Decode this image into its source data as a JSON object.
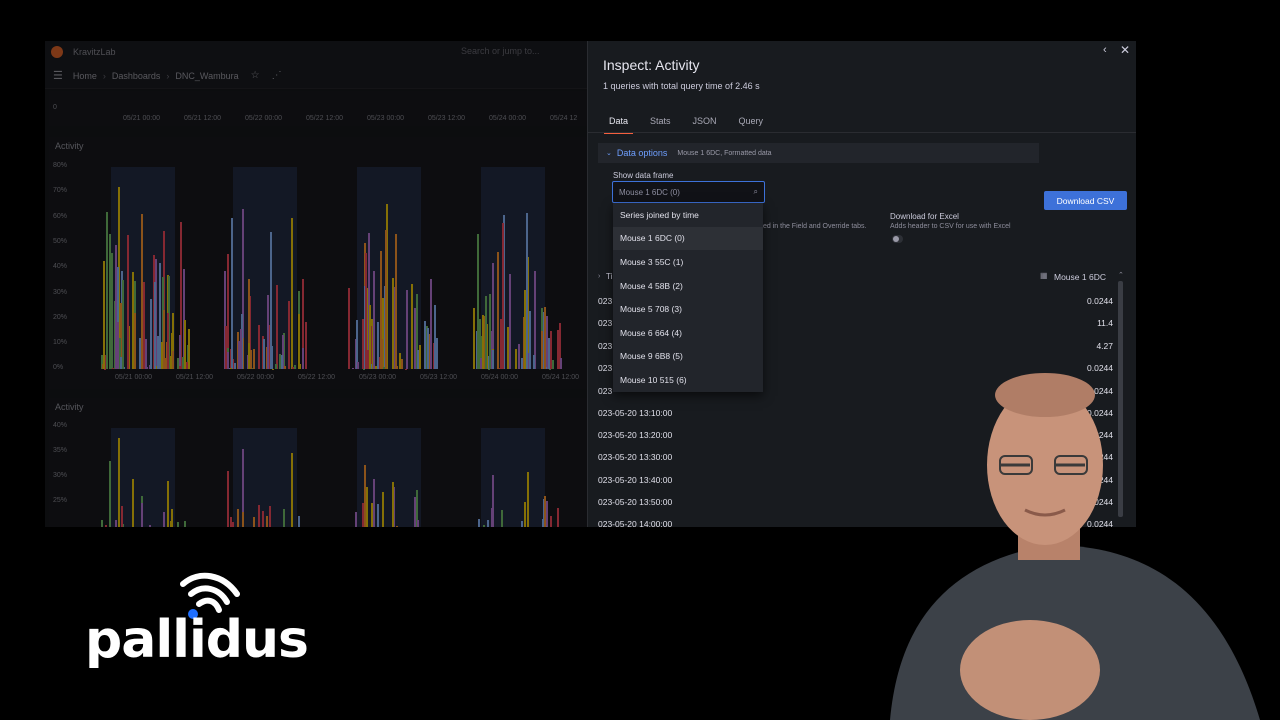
{
  "dashboard": {
    "org": "KravitzLab",
    "search_placeholder": "Search or jump to...",
    "breadcrumb": [
      "Home",
      "Dashboards",
      "DNC_Wambura"
    ],
    "top_panel_x_ticks": [
      "05/21 00:00",
      "05/21 12:00",
      "05/22 00:00",
      "05/22 12:00",
      "05/23 00:00",
      "05/23 12:00",
      "05/24 00:00",
      "05/24 12"
    ],
    "top_panel_y_tick": "0",
    "panel1": {
      "title": "Activity",
      "y_ticks": [
        "80%",
        "70%",
        "60%",
        "50%",
        "40%",
        "30%",
        "20%",
        "10%",
        "0%"
      ],
      "x_ticks": [
        "05/21 00:00",
        "05/21 12:00",
        "05/22 00:00",
        "05/22 12:00",
        "05/23 00:00",
        "05/23 12:00",
        "05/24 00:00",
        "05/24 12:00"
      ]
    },
    "panel2": {
      "title": "Activity",
      "y_ticks": [
        "40%",
        "35%",
        "30%",
        "25%"
      ]
    }
  },
  "inspect": {
    "title": "Inspect: Activity",
    "subtitle": "1 queries with total query time of 2.46 s",
    "tabs": [
      "Data",
      "Stats",
      "JSON",
      "Query"
    ],
    "active_tab": "Data",
    "data_options": {
      "label": "Data options",
      "summary": "Mouse 1 6DC, Formatted data"
    },
    "show_frame": {
      "label": "Show data frame",
      "value": "Mouse 1 6DC (0)",
      "options": [
        "Series joined by time",
        "Mouse 1 6DC (0)",
        "Mouse 3 55C (1)",
        "Mouse 4 58B (2)",
        "Mouse 5 708 (3)",
        "Mouse 6 664 (4)",
        "Mouse 9 6B8 (5)",
        "Mouse 10 515 (6)"
      ]
    },
    "field_hint": "ed in the Field and Override tabs.",
    "excel": {
      "label": "Download for Excel",
      "desc": "Adds header to CSV for use with Excel"
    },
    "download_button": "Download CSV",
    "table": {
      "time_header": "Ti",
      "value_header": "Mouse 1 6DC",
      "rows": [
        {
          "time": "023",
          "value": "0.0244"
        },
        {
          "time": "023",
          "value": "11.4"
        },
        {
          "time": "023",
          "value": "4.27"
        },
        {
          "time": "023",
          "value": "0.0244"
        },
        {
          "time": "023",
          "value": "0.0244"
        },
        {
          "time": "023-05-20 13:10:00",
          "value": "0.0244"
        },
        {
          "time": "023-05-20 13:20:00",
          "value": "0.0244"
        },
        {
          "time": "023-05-20 13:30:00",
          "value": "0.0244"
        },
        {
          "time": "023-05-20 13:40:00",
          "value": "0.0244"
        },
        {
          "time": "023-05-20 13:50:00",
          "value": "0.0244"
        },
        {
          "time": "023-05-20 14:00:00",
          "value": "0.0244"
        }
      ]
    }
  },
  "brand": {
    "name": "pallidus"
  },
  "colors": {
    "accent_blue": "#3d71d9",
    "tab_underline": "#f55f3e",
    "drawer_bg": "#181b1f",
    "brand_blue": "#1f6fff"
  }
}
